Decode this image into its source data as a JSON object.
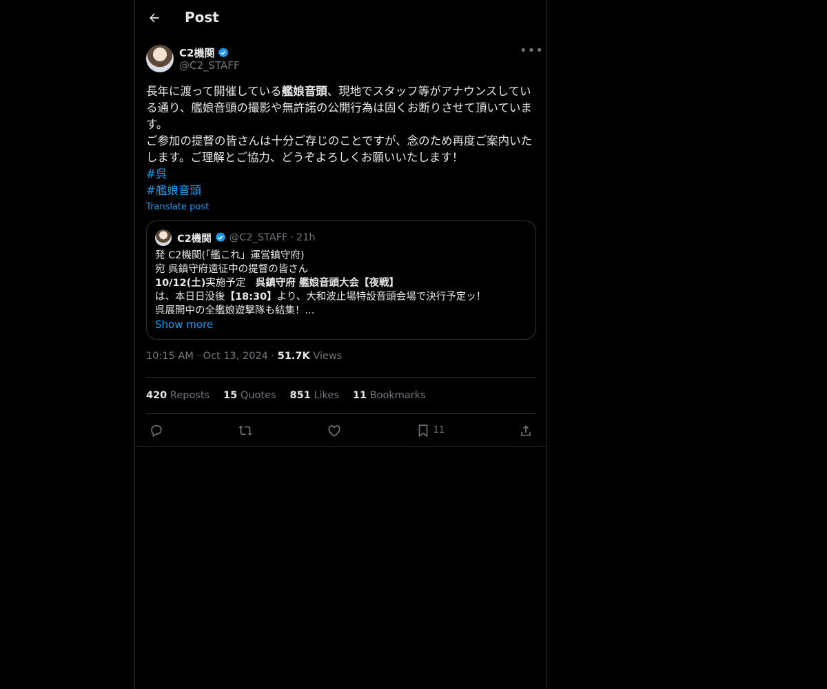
{
  "header": {
    "title": "Post"
  },
  "post": {
    "author_name": "C2機関",
    "author_handle": "@C2_STAFF",
    "text_part1": "長年に渡って開催している",
    "text_bold1": "艦娘音頭",
    "text_part2": "、現地でスタッフ等がアナウンスしている通り、艦娘音頭の撮影や無許諾の公開行為は固くお断りさせて頂いています。\nご参加の提督の皆さんは十分ご存じのことですが、念のため再度ご案内いたします。ご理解とご協力、どうぞよろしくお願いいたします！",
    "hashtag1": "#呉",
    "hashtag2": "#艦娘音頭",
    "translate": "Translate post"
  },
  "quote": {
    "author_name": "C2機関",
    "author_handle": "@C2_STAFF",
    "separator": "·",
    "time": "21h",
    "line1": "発 C2機関(「艦これ」運営鎮守府)",
    "line2": "宛 呉鎮守府遠征中の提督の皆さん",
    "line3_bold_a": "10/12(土)",
    "line3_mid": "実施予定　",
    "line3_bold_b": "呉鎮守府 艦娘音頭大会【夜戦】",
    "line4_a": "は、本日日没後",
    "line4_bold": "【18:30】",
    "line4_b": "より、大和波止場特設音頭会場で決行予定ッ！",
    "line5": "呉展開中の全艦娘遊撃隊も結集！...",
    "show_more": "Show more"
  },
  "meta": {
    "time": "10:15 AM",
    "dot": "·",
    "date": "Oct 13, 2024",
    "views_count": "51.7K",
    "views_label": "Views"
  },
  "stats": {
    "reposts_count": "420",
    "reposts_label": "Reposts",
    "quotes_count": "15",
    "quotes_label": "Quotes",
    "likes_count": "851",
    "likes_label": "Likes",
    "bookmarks_count": "11",
    "bookmarks_label": "Bookmarks"
  },
  "actions": {
    "bookmark_count": "11"
  },
  "colors": {
    "accent": "#1d9bf0",
    "background": "#000000",
    "muted": "#71767b",
    "border": "#2f3336"
  },
  "icons": [
    "back-arrow-icon",
    "verified-badge-icon",
    "more-icon",
    "reply-icon",
    "repost-icon",
    "like-icon",
    "bookmark-icon",
    "share-icon"
  ]
}
